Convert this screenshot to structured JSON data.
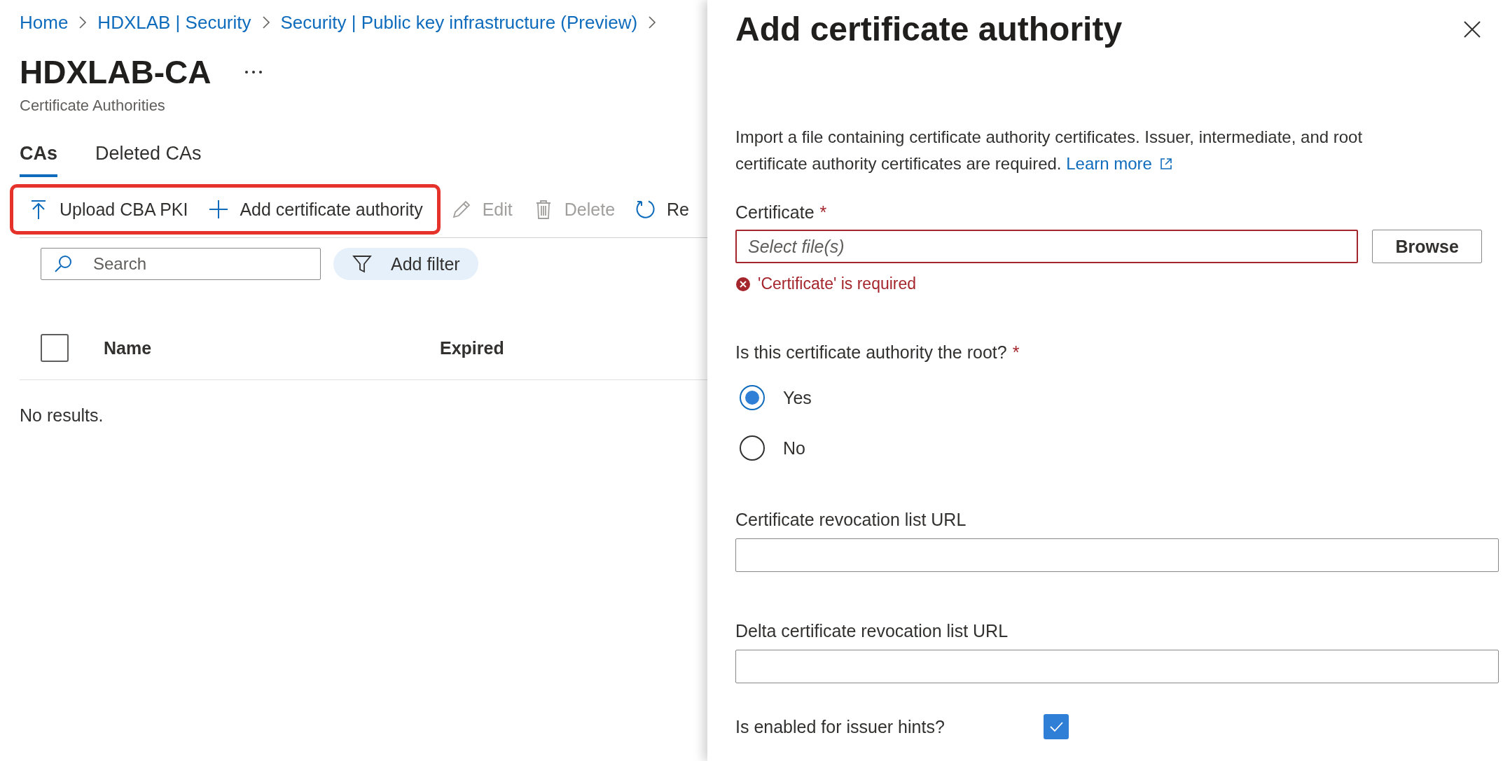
{
  "breadcrumb": [
    {
      "label": "Home"
    },
    {
      "label": "HDXLAB | Security"
    },
    {
      "label": "Security | Public key infrastructure (Preview)"
    }
  ],
  "page": {
    "title": "HDXLAB-CA",
    "subtitle": "Certificate Authorities"
  },
  "tabs": [
    {
      "label": "CAs",
      "selected": true
    },
    {
      "label": "Deleted CAs",
      "selected": false
    }
  ],
  "toolbar": [
    {
      "label": "Upload CBA PKI",
      "kind": "upload",
      "disabled": false,
      "highlighted": true
    },
    {
      "label": "Add certificate authority",
      "kind": "add",
      "disabled": false,
      "highlighted": true
    },
    {
      "label": "Edit",
      "kind": "edit",
      "disabled": true,
      "highlighted": false
    },
    {
      "label": "Delete",
      "kind": "delete",
      "disabled": true,
      "highlighted": false
    },
    {
      "label": "Re",
      "kind": "refresh",
      "disabled": false,
      "highlighted": false
    }
  ],
  "search": {
    "placeholder": "Search"
  },
  "filter_button": {
    "label": "Add filter"
  },
  "table": {
    "select_all_checked": false,
    "columns": [
      "Name",
      "Expired"
    ],
    "empty_text": "No results."
  },
  "panel": {
    "title": "Add certificate authority",
    "description": "Import a file containing certificate authority certificates. Issuer, intermediate, and root certificate authority certificates are required.",
    "learn_more": "Learn more",
    "fields": [
      {
        "kind": "file",
        "label": "Certificate",
        "required_mark": "*",
        "placeholder": "Select file(s)",
        "button": "Browse",
        "error": "'Certificate' is required"
      },
      {
        "kind": "radio",
        "label": "Is this certificate authority the root?",
        "required_mark": "*",
        "options": [
          {
            "label": "Yes",
            "selected": true
          },
          {
            "label": "No",
            "selected": false
          }
        ]
      },
      {
        "kind": "text",
        "label": "Certificate revocation list URL"
      },
      {
        "kind": "text",
        "label": "Delta certificate revocation list URL"
      },
      {
        "kind": "checkbox",
        "label": "Is enabled for issuer hints?",
        "checked": true
      }
    ]
  }
}
